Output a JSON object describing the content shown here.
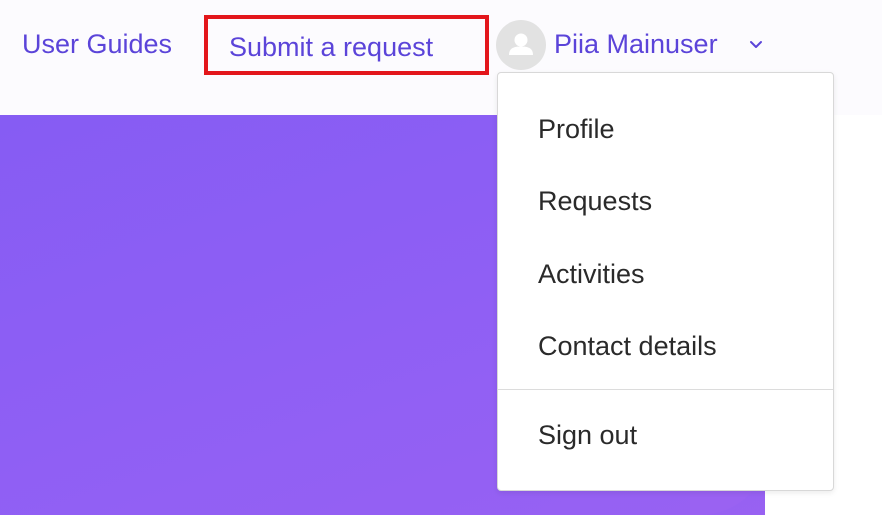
{
  "colors": {
    "link": "#5b44d9",
    "highlight_border": "#e3161b",
    "hero_gradient_start": "#865cf3",
    "hero_gradient_end": "#9a62f2",
    "menu_text": "#2a2a2a"
  },
  "header": {
    "nav": {
      "user_guides": "User Guides",
      "submit_request": "Submit a request"
    },
    "user": {
      "avatar_icon": "user-silhouette-icon",
      "name": "Piia Mainuser",
      "chevron_icon": "chevron-down-icon"
    }
  },
  "user_menu": {
    "items": [
      {
        "label": "Profile"
      },
      {
        "label": "Requests"
      },
      {
        "label": "Activities"
      },
      {
        "label": "Contact details"
      }
    ],
    "sign_out": "Sign out"
  }
}
